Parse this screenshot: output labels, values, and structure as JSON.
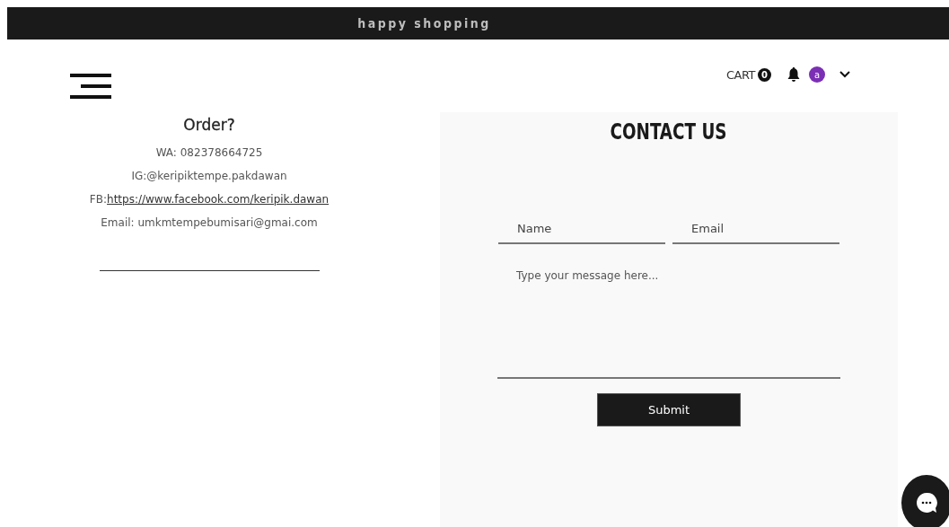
{
  "banner": {
    "title": "happy shopping"
  },
  "header": {
    "cart_label": "CART",
    "cart_count": "0",
    "avatar_letter": "a"
  },
  "order": {
    "title": "Order?",
    "lines": [
      {
        "kind": "text",
        "text": "WA: 082378664725"
      },
      {
        "kind": "text",
        "text": "IG:@keripiktempe.pakdawan"
      },
      {
        "kind": "link",
        "prefix": "FB:",
        "text": "https://www.facebook.com/keripik.dawan"
      },
      {
        "kind": "text",
        "text": "Email: umkmtempebumisari@gmai.com"
      }
    ]
  },
  "contact": {
    "title": "CONTACT US",
    "fields": [
      {
        "placeholder": "Name"
      },
      {
        "placeholder": "Email"
      }
    ],
    "message": {
      "placeholder": "Type your message here..."
    },
    "submit": "Submit"
  }
}
